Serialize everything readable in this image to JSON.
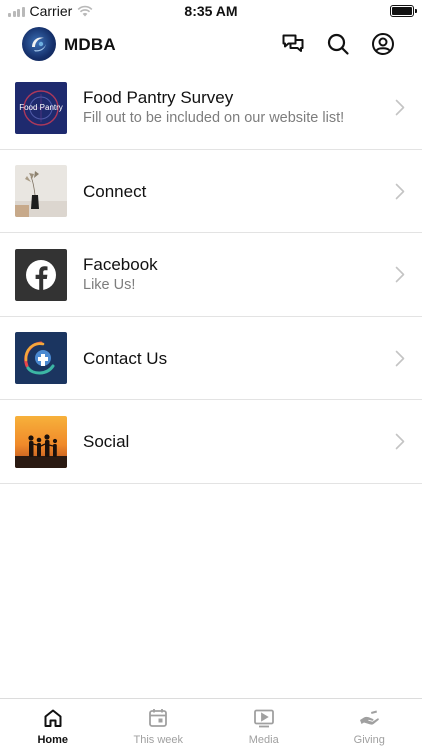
{
  "status_bar": {
    "carrier": "Carrier",
    "time": "8:35 AM"
  },
  "header": {
    "title": "MDBA",
    "icons": [
      "chat-icon",
      "search-icon",
      "profile-icon"
    ]
  },
  "items": [
    {
      "title": "Food Pantry Survey",
      "subtitle": "Fill out to be included on our website list!",
      "thumb_text": "Food Pantry",
      "thumb": "food-pantry-thumbnail"
    },
    {
      "title": "Connect",
      "subtitle": "",
      "thumb": "connect-thumbnail"
    },
    {
      "title": "Facebook",
      "subtitle": "Like Us!",
      "thumb": "facebook-thumbnail"
    },
    {
      "title": "Contact Us",
      "subtitle": "",
      "thumb": "contact-thumbnail"
    },
    {
      "title": "Social",
      "subtitle": "",
      "thumb": "social-thumbnail"
    }
  ],
  "tabs": [
    {
      "label": "Home",
      "icon": "home-icon",
      "active": true
    },
    {
      "label": "This week",
      "icon": "calendar-icon",
      "active": false
    },
    {
      "label": "Media",
      "icon": "media-icon",
      "active": false
    },
    {
      "label": "Giving",
      "icon": "giving-icon",
      "active": false
    }
  ],
  "colors": {
    "active_tab": "#111111",
    "inactive_tab": "#a0a0a0",
    "subtitle": "#7d7d7d",
    "divider": "#e3e3e3",
    "facebook_tile": "#333333"
  }
}
